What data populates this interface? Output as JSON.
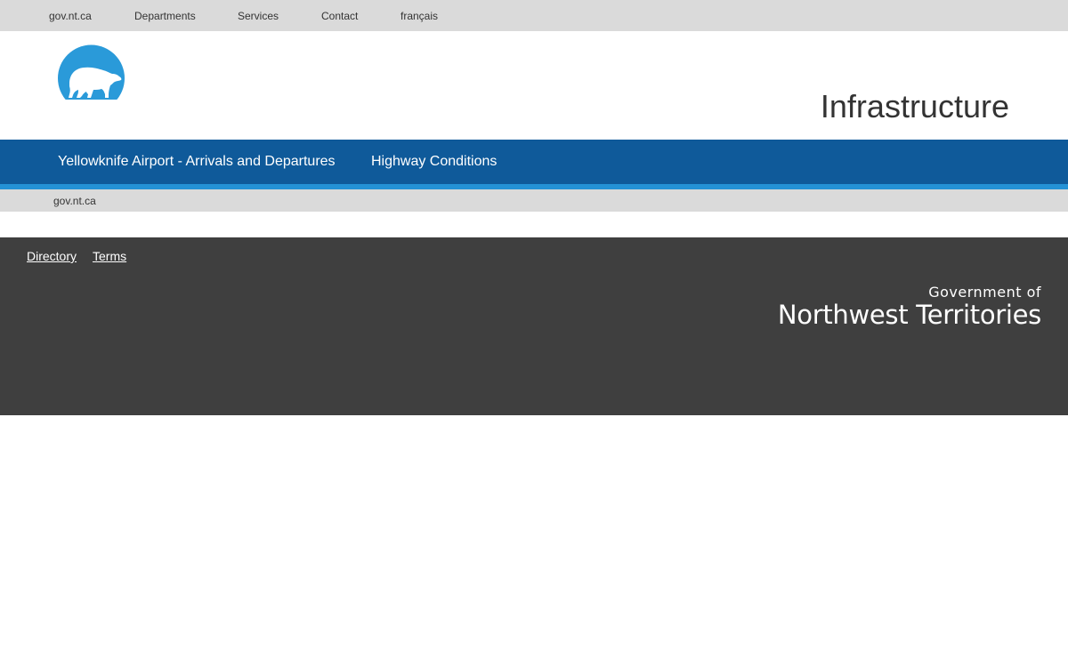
{
  "top_bar": {
    "links": [
      {
        "label": "gov.nt.ca"
      },
      {
        "label": "Departments"
      },
      {
        "label": "Services"
      },
      {
        "label": "Contact"
      },
      {
        "label": "français"
      }
    ]
  },
  "header": {
    "logo_icon": "polar-bear-icon",
    "title": "Infrastructure"
  },
  "main_nav": {
    "items": [
      {
        "label": "Yellowknife Airport - Arrivals and Departures"
      },
      {
        "label": "Highway Conditions"
      }
    ]
  },
  "breadcrumb": {
    "items": [
      {
        "label": "gov.nt.ca"
      }
    ]
  },
  "footer": {
    "links": [
      {
        "label": "Directory"
      },
      {
        "label": "Terms"
      }
    ],
    "gov_logo": {
      "line1": "Government of",
      "line2": "Northwest Territories"
    }
  },
  "colors": {
    "top_bar": "#dadada",
    "nav": "#0f5a9a",
    "nav_stripe": "#2492d6",
    "footer": "#3f3f3f",
    "logo_blue": "#2a9ad9"
  }
}
